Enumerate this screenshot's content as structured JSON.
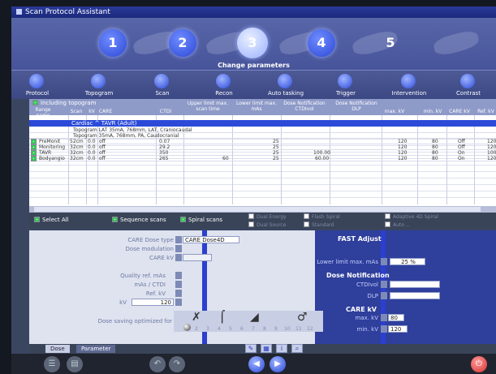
{
  "window": {
    "title": "Scan Protocol Assistant"
  },
  "steps": {
    "items": [
      "1",
      "2",
      "3",
      "4",
      "5"
    ],
    "active": 2,
    "caption": "Change parameters"
  },
  "tasks": [
    "Protocol",
    "Topogram",
    "Scan",
    "Recon",
    "Auto tasking",
    "Trigger",
    "Intervention",
    "Contrast"
  ],
  "grid": {
    "topogram_check_label": "Including topogram",
    "columns": [
      "Range name",
      "Scan",
      "kV",
      "CARE",
      "CTDI",
      "Upper limit max. scan time",
      "Lower limit max. mAs",
      "Dose Notification CTDIvol",
      "Dose Notification DLP",
      "max. kV",
      "min. kV",
      "CARE kV",
      "Ref. kV"
    ],
    "group": "Cardiac ^ TAVR (Adult)",
    "rows": [
      {
        "name": "",
        "text": "Topogram LAT 35mA, 768mm, LAT, Craniocaudal"
      },
      {
        "name": "",
        "text": "Topogram 35mA, 768mm, PA, Caudocranial"
      },
      {
        "name": "PreMonit",
        "len": "52cm",
        "a": "0.0",
        "b": "off",
        "ctdi": "0.07",
        "lower": "25",
        "n1": "",
        "n2": "",
        "max": "120",
        "min": "80",
        "care": "Off",
        "ref": "120"
      },
      {
        "name": "Monitoring",
        "len": "32cm",
        "a": "0.0",
        "b": "off",
        "ctdi": "29.2",
        "lower": "25",
        "n1": "",
        "n2": "",
        "max": "120",
        "min": "80",
        "care": "Off",
        "ref": "120"
      },
      {
        "name": "TAVR",
        "len": "32cm",
        "a": "0.0",
        "b": "off",
        "ctdi": "350",
        "lower": "25",
        "n1": "100.00",
        "n2": "",
        "max": "120",
        "min": "80",
        "care": "On",
        "ref": "100"
      },
      {
        "name": "Bodyangio",
        "len": "32cm",
        "a": "0.0",
        "b": "off",
        "ctdi": "265",
        "upper": "60",
        "lower": "25",
        "n1": "60.00",
        "n2": "",
        "max": "120",
        "min": "80",
        "care": "On",
        "ref": "120"
      }
    ]
  },
  "selection": {
    "select_all": "Select All",
    "sequence_scans": "Sequence scans",
    "spiral_scans": "Spiral scans",
    "dim_items": [
      "Dual Energy",
      "Flash Spiral",
      "Dual Source",
      "Adaptive 4D Spiral",
      "Standard",
      "Auto ..."
    ]
  },
  "left_panel": {
    "care_dose_type_label": "CARE Dose type",
    "care_dose_type_value": "CARE Dose4D",
    "dose_modulation_label": "Dose modulation",
    "care_kv_label": "CARE kV",
    "quality_ref_label": "Quality ref. mAs",
    "mas_ctdi_label": "mAs / CTDI",
    "ref_kv_label": "Ref. kV",
    "kv_label": "kV",
    "kv_value": "120",
    "slider_label": "Dose saving optimized for",
    "slider_ticks": [
      "1",
      "2",
      "3",
      "4",
      "5",
      "6",
      "7",
      "8",
      "9",
      "10",
      "11",
      "12"
    ]
  },
  "right_panel": {
    "fast_adjust_title": "FAST Adjust",
    "lower_limit_label": "Lower limit max. mAs",
    "lower_limit_value": "25 %",
    "dose_notification_title": "Dose Notification",
    "ctdivol_label": "CTDIvol",
    "dlp_label": "DLP",
    "care_kv_title": "CARE kV",
    "max_kv_label": "max. kV",
    "max_kv_value": "80",
    "min_kv_label": "min. kV",
    "min_kv_value": "120"
  },
  "tabs": [
    "Dose",
    "Parameter"
  ]
}
